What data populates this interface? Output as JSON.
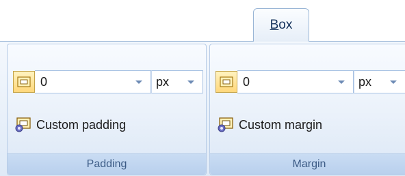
{
  "tab": {
    "mnemonic": "B",
    "rest": "ox"
  },
  "groups": {
    "padding": {
      "caption": "Padding",
      "value": "0",
      "unit": "px",
      "custom_label": "Custom padding"
    },
    "margin": {
      "caption": "Margin",
      "value": "0",
      "unit": "px",
      "custom_label": "Custom margin"
    }
  },
  "icons": {
    "box_icon": "box-icon",
    "custom_icon": "custom-box-gear-icon"
  },
  "colors": {
    "ribbon_border": "#9ab6d6",
    "caption_text": "#3b5a85",
    "icon_fill": "#ffd77a"
  }
}
